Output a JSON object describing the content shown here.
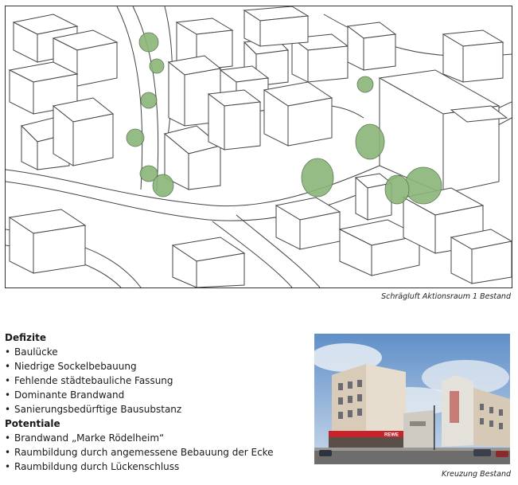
{
  "figure1": {
    "caption": "Schrägluft Aktionsraum 1 Bestand"
  },
  "figure2": {
    "caption": "Kreuzung Bestand",
    "sign_text": "REWE"
  },
  "defizite": {
    "heading": "Defizite",
    "items": [
      "Baulücke",
      "Niedrige Sockelbebauung",
      "Fehlende städtebauliche Fassung",
      "Dominante Brandwand",
      "Sanierungsbedürftige Bausubstanz"
    ]
  },
  "potentiale": {
    "heading": "Potentiale",
    "items": [
      "Brandwand „Marke Rödelheim“",
      "Raumbildung durch angemessene Bebauung der Ecke",
      "Raumbildung durch Lückenschluss"
    ]
  },
  "colors": {
    "tree_green": "#8bb57a",
    "sky_blue": "#5f8fc9",
    "storefront_red": "#c8222b"
  }
}
